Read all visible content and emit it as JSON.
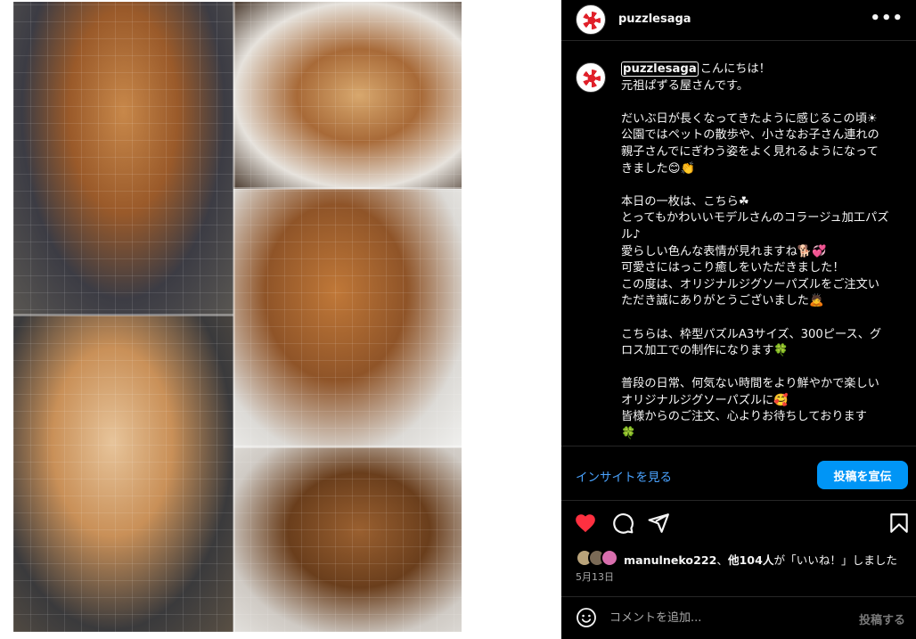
{
  "post": {
    "username": "puzzlesaga",
    "more_icon": "more-horizontal-icon"
  },
  "caption": {
    "username": "puzzlesaga",
    "lines": [
      "こんにちは！",
      "元祖ぱずる屋さんです。",
      "",
      "だいぶ日が長くなってきたように感じるこの頃☀",
      "公園ではペットの散歩や、小さなお子さん連れの",
      "親子さんでにぎわう姿をよく見れるようになって",
      "きました😊👏",
      "",
      "本日の一枚は、こちら☘",
      "とってもかわいいモデルさんのコラージュ加工パズ",
      "ル♪",
      "愛らしい色んな表情が見れますね🐕💞",
      "可愛さにはっこり癒しをいただきました！",
      "この度は、オリジナルジグソーパズルをご注文い",
      "ただき誠にありがとうございました🙇",
      "",
      "こちらは、枠型パズルA3サイズ、300ピース、グ",
      "ロス加工での制作になります🍀",
      "",
      "普段の日常、何気ない時間をより鮮やかで楽しい",
      "オリジナルジグソーパズルに🥰",
      "皆様からのご注文、心よりお待ちしております",
      "🍀"
    ]
  },
  "insights": {
    "link_label": "インサイトを見る",
    "promote_label": "投稿を宣伝"
  },
  "actions": {
    "like_icon": "heart-filled-icon",
    "comment_icon": "comment-icon",
    "share_icon": "share-icon",
    "save_icon": "bookmark-icon",
    "like_color": "#ff3040"
  },
  "likes": {
    "user": "manulneko222",
    "sep": "、",
    "others": "他104人",
    "suffix": "が「いいね！」しました"
  },
  "date": "5月13日",
  "comment": {
    "placeholder": "コメントを追加...",
    "post_label": "投稿する"
  },
  "colors": {
    "panel_bg": "#000000",
    "accent": "#0095f6",
    "link": "#4aa3ff"
  }
}
